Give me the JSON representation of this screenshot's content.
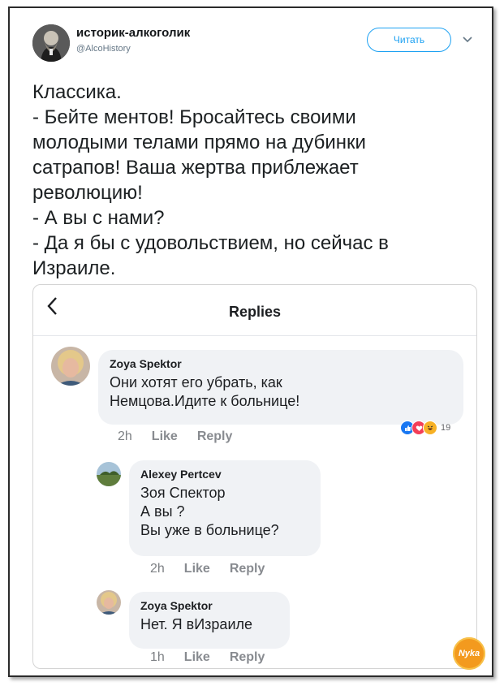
{
  "tweet": {
    "author_name": "историк-алкоголик",
    "author_handle": "@AlcoHistory",
    "follow_label": "Читать",
    "menu_icon": "chevron-down-icon",
    "lines": [
      "Классика.",
      "- Бейте ментов! Бросайтесь своими",
      "молодыми телами прямо на дубинки",
      "сатрапов! Ваша жертва приблежает",
      "революцию!",
      "- А вы с нами?",
      "- Да я бы с удовольствием, но сейчас в",
      "Израиле."
    ]
  },
  "replies_card": {
    "title": "Replies",
    "back_icon": "chevron-left-icon",
    "comments": [
      {
        "author": "Zoya Spektor",
        "lines": [
          "Они хотят его убрать, как",
          "Немцова.Идите к больнице!"
        ],
        "time": "2h",
        "like_label": "Like",
        "reply_label": "Reply",
        "reaction_count": "19"
      },
      {
        "author": "Alexey Pertcev",
        "lines": [
          "Зоя Спектор",
          "А вы ?",
          "Вы уже в больнице?"
        ],
        "time": "2h",
        "like_label": "Like",
        "reply_label": "Reply"
      },
      {
        "author": "Zoya Spektor",
        "lines": [
          "Нет. Я вИзраиле"
        ],
        "time": "1h",
        "like_label": "Like",
        "reply_label": "Reply"
      }
    ]
  },
  "colors": {
    "twitter_blue": "#1da1f2",
    "bubble_bg": "#f0f2f5",
    "like_reaction": "#1877f2",
    "love_reaction": "#f33e58",
    "haha_reaction": "#f7b125"
  },
  "watermark": "Nyka"
}
